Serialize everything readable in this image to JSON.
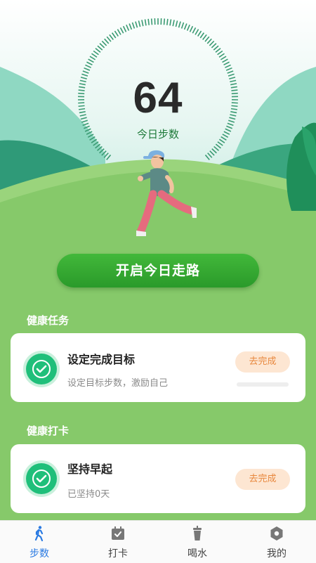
{
  "dashboard": {
    "steps_today": "64",
    "steps_label": "今日步数",
    "start_button": "开启今日走路"
  },
  "tasks_section": {
    "title": "健康任务",
    "card": {
      "title": "设定完成目标",
      "subtitle": "设定目标步数，激励自己",
      "action": "去完成",
      "progress": 0
    }
  },
  "checkin_section": {
    "title": "健康打卡",
    "card": {
      "title": "坚持早起",
      "subtitle": "已坚持0天",
      "action": "去完成"
    }
  },
  "tabbar": {
    "tabs": [
      {
        "label": "步数",
        "icon": "walking-icon",
        "active": true
      },
      {
        "label": "打卡",
        "icon": "calendar-check-icon",
        "active": false
      },
      {
        "label": "喝水",
        "icon": "cup-icon",
        "active": false
      },
      {
        "label": "我的",
        "icon": "hexagon-settings-icon",
        "active": false
      }
    ]
  },
  "colors": {
    "accent": "#2a9a2a",
    "tab_active": "#2a7ae2",
    "badge": "#1fbf7a",
    "action_text": "#e8883e"
  }
}
